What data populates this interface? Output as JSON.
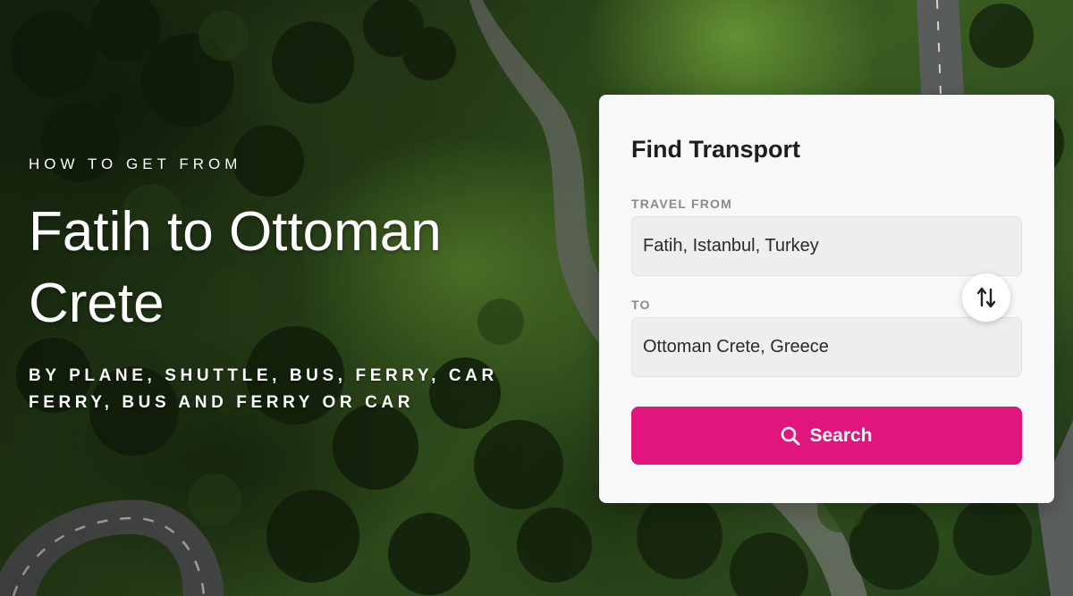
{
  "hero": {
    "eyebrow": "HOW TO GET FROM",
    "headline": "Fatih to Ottoman Crete",
    "subline": "BY PLANE, SHUTTLE, BUS, FERRY, CAR FERRY, BUS AND FERRY OR CAR"
  },
  "form": {
    "title": "Find Transport",
    "from_label": "TRAVEL FROM",
    "from_value": "Fatih, Istanbul, Turkey",
    "to_label": "TO",
    "to_value": "Ottoman Crete, Greece",
    "swap_icon": "swap-vertical-icon",
    "search_icon": "search-icon",
    "search_label": "Search"
  },
  "colors": {
    "accent": "#e0157e",
    "card_bg": "#f8f8f8",
    "field_bg": "#eeeeee"
  }
}
